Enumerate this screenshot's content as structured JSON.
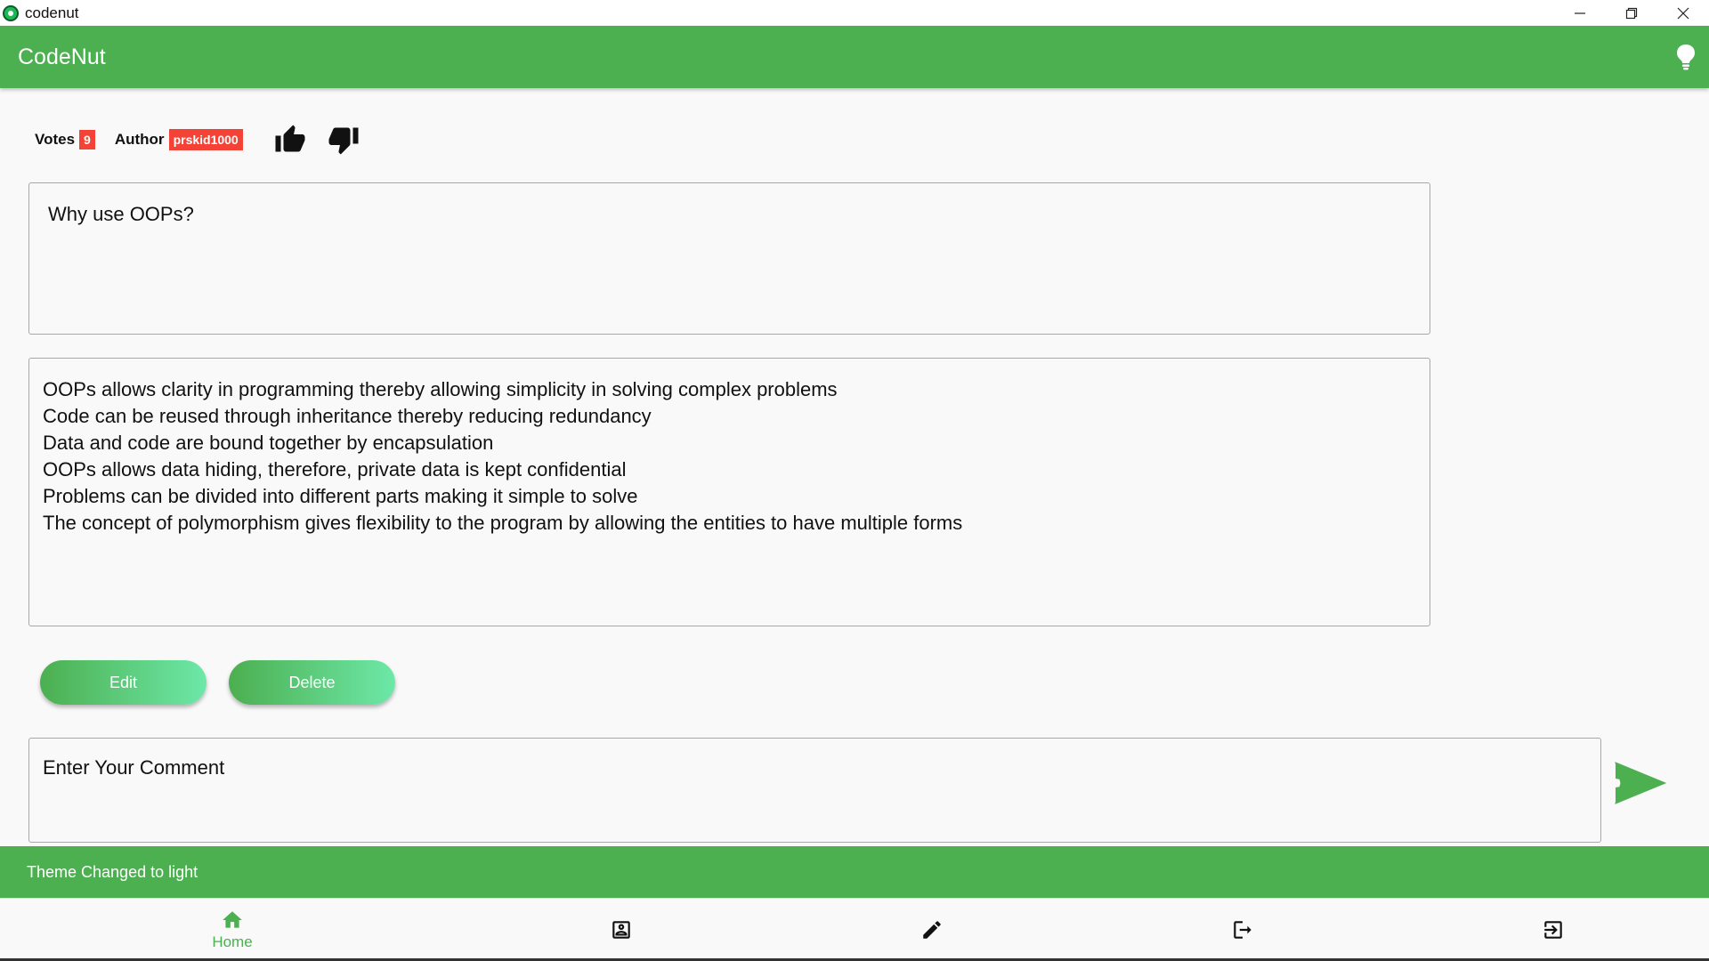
{
  "window": {
    "title": "codenut",
    "controls": [
      "minimize",
      "restore",
      "close"
    ]
  },
  "appbar": {
    "brand": "CodeNut",
    "theme_icon": "lightbulb-icon"
  },
  "meta": {
    "votes_label": "Votes",
    "votes_count": "9",
    "author_label": "Author",
    "author_name": "prskid1000"
  },
  "question": {
    "text": "Why use OOPs?"
  },
  "answer": {
    "lines": [
      "OOPs allows clarity in programming thereby allowing simplicity in solving complex problems",
      "Code can be reused through inheritance thereby reducing redundancy",
      "Data and code are bound together by encapsulation",
      "OOPs allows data hiding, therefore, private data is kept confidential",
      "Problems can be divided into different parts making it simple to solve",
      "The concept of polymorphism gives flexibility to the program by allowing the entities to have multiple forms"
    ]
  },
  "actions": {
    "edit_label": "Edit",
    "delete_label": "Delete"
  },
  "comment": {
    "placeholder": "Enter Your Comment"
  },
  "snackbar": {
    "message": "Theme Changed to light"
  },
  "bottom_nav": {
    "home_label": "Home"
  },
  "colors": {
    "primary": "#4caf50",
    "badge": "#f44336"
  }
}
